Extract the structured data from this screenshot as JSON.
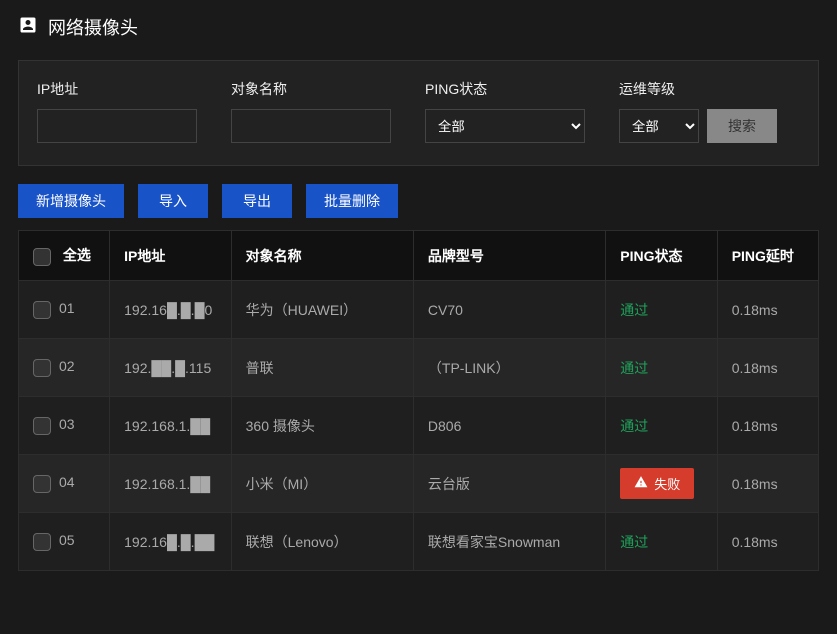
{
  "header": {
    "title": "网络摄像头"
  },
  "filters": {
    "ip_label": "IP地址",
    "ip_value": "",
    "name_label": "对象名称",
    "name_value": "",
    "ping_label": "PING状态",
    "ping_selected": "全部",
    "level_label": "运维等级",
    "level_selected": "全部",
    "search_btn": "搜索"
  },
  "actions": {
    "add": "新增摄像头",
    "import": "导入",
    "export": "导出",
    "batch_delete": "批量删除"
  },
  "table": {
    "headers": {
      "select_all": "全选",
      "ip": "IP地址",
      "name": "对象名称",
      "model": "品牌型号",
      "ping": "PING状态",
      "delay": "PING延时"
    },
    "status_text": {
      "pass": "通过",
      "fail": "失败"
    },
    "rows": [
      {
        "idx": "01",
        "ip": "192.16█.█.█0",
        "name": "华为（HUAWEI）",
        "model": "CV70",
        "ping": "pass",
        "delay": "0.18ms"
      },
      {
        "idx": "02",
        "ip": "192.██.█.115",
        "name": "普联",
        "model": "（TP-LINK）",
        "ping": "pass",
        "delay": "0.18ms"
      },
      {
        "idx": "03",
        "ip": "192.168.1.██",
        "name": "360 摄像头",
        "model": "D806",
        "ping": "pass",
        "delay": "0.18ms"
      },
      {
        "idx": "04",
        "ip": "192.168.1.██",
        "name": "小米（MI）",
        "model": "云台版",
        "ping": "fail",
        "delay": "0.18ms"
      },
      {
        "idx": "05",
        "ip": "192.16█.█.██",
        "name": "联想（Lenovo）",
        "model": "联想看家宝Snowman",
        "ping": "pass",
        "delay": "0.18ms"
      }
    ]
  }
}
